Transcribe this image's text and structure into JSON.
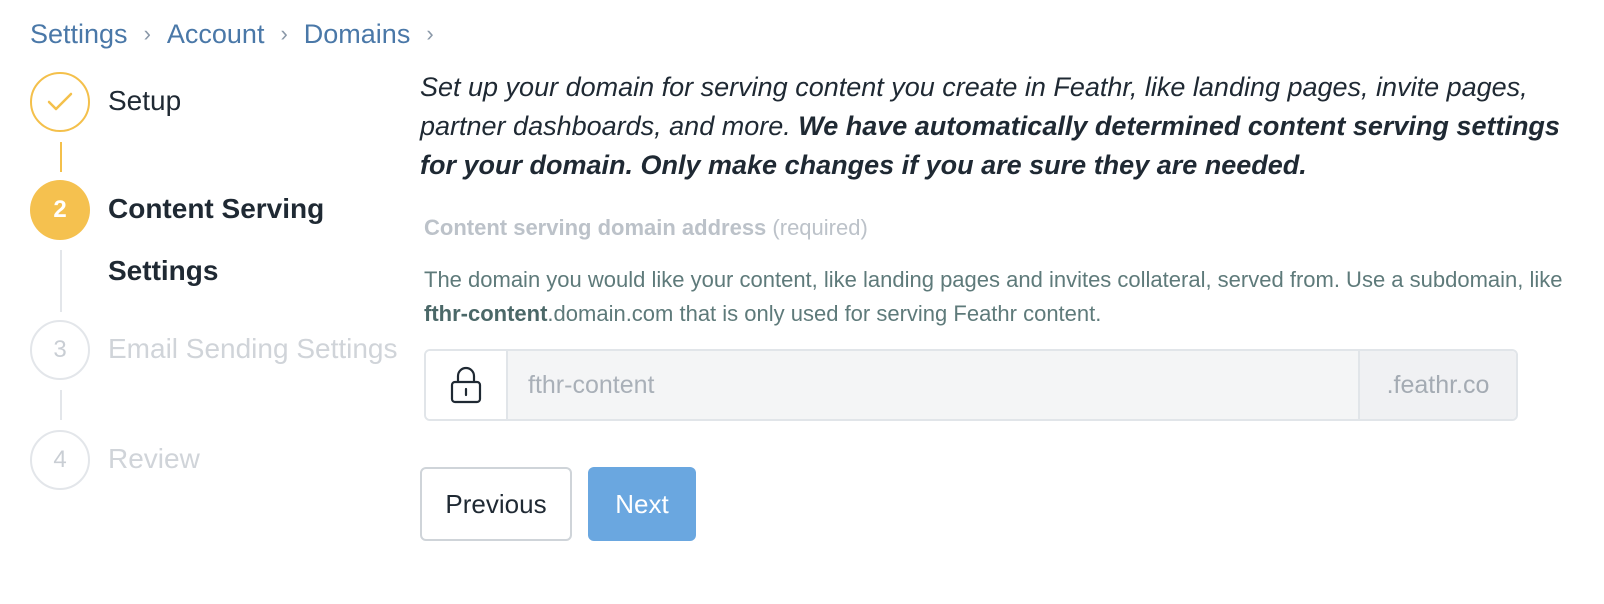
{
  "breadcrumb": {
    "items": [
      "Settings",
      "Account",
      "Domains"
    ],
    "separator": "›"
  },
  "stepper": {
    "steps": [
      {
        "label": "Setup",
        "status": "completed",
        "icon": "check-icon"
      },
      {
        "number": "2",
        "label": "Content Serving Settings",
        "status": "active"
      },
      {
        "number": "3",
        "label": "Email Sending Settings",
        "status": "pending"
      },
      {
        "number": "4",
        "label": "Review",
        "status": "pending"
      }
    ]
  },
  "main": {
    "intro_text": "Set up your domain for serving content you create in Feathr, like landing pages, invite pages, partner dashboards, and more. ",
    "intro_bold": "We have automatically determined content serving settings for your domain. Only make changes if you are sure they are needed.",
    "field": {
      "label": "Content serving domain address",
      "required": "(required)",
      "help_before": "The domain you would like your content, like landing pages and invites collateral, served from. Use a subdomain, like ",
      "help_bold": "fthr-content",
      "help_after": ".domain.com that is only used for serving Feathr content.",
      "lock_icon": "lock-icon",
      "placeholder": "fthr-content",
      "value": "",
      "suffix": ".feathr.co"
    },
    "buttons": {
      "previous": "Previous",
      "next": "Next"
    }
  },
  "colors": {
    "accent_gold": "#f5c14f",
    "link_blue": "#4a78a8",
    "next_button": "#6aa7e0",
    "help_text": "#5e7a7a"
  }
}
